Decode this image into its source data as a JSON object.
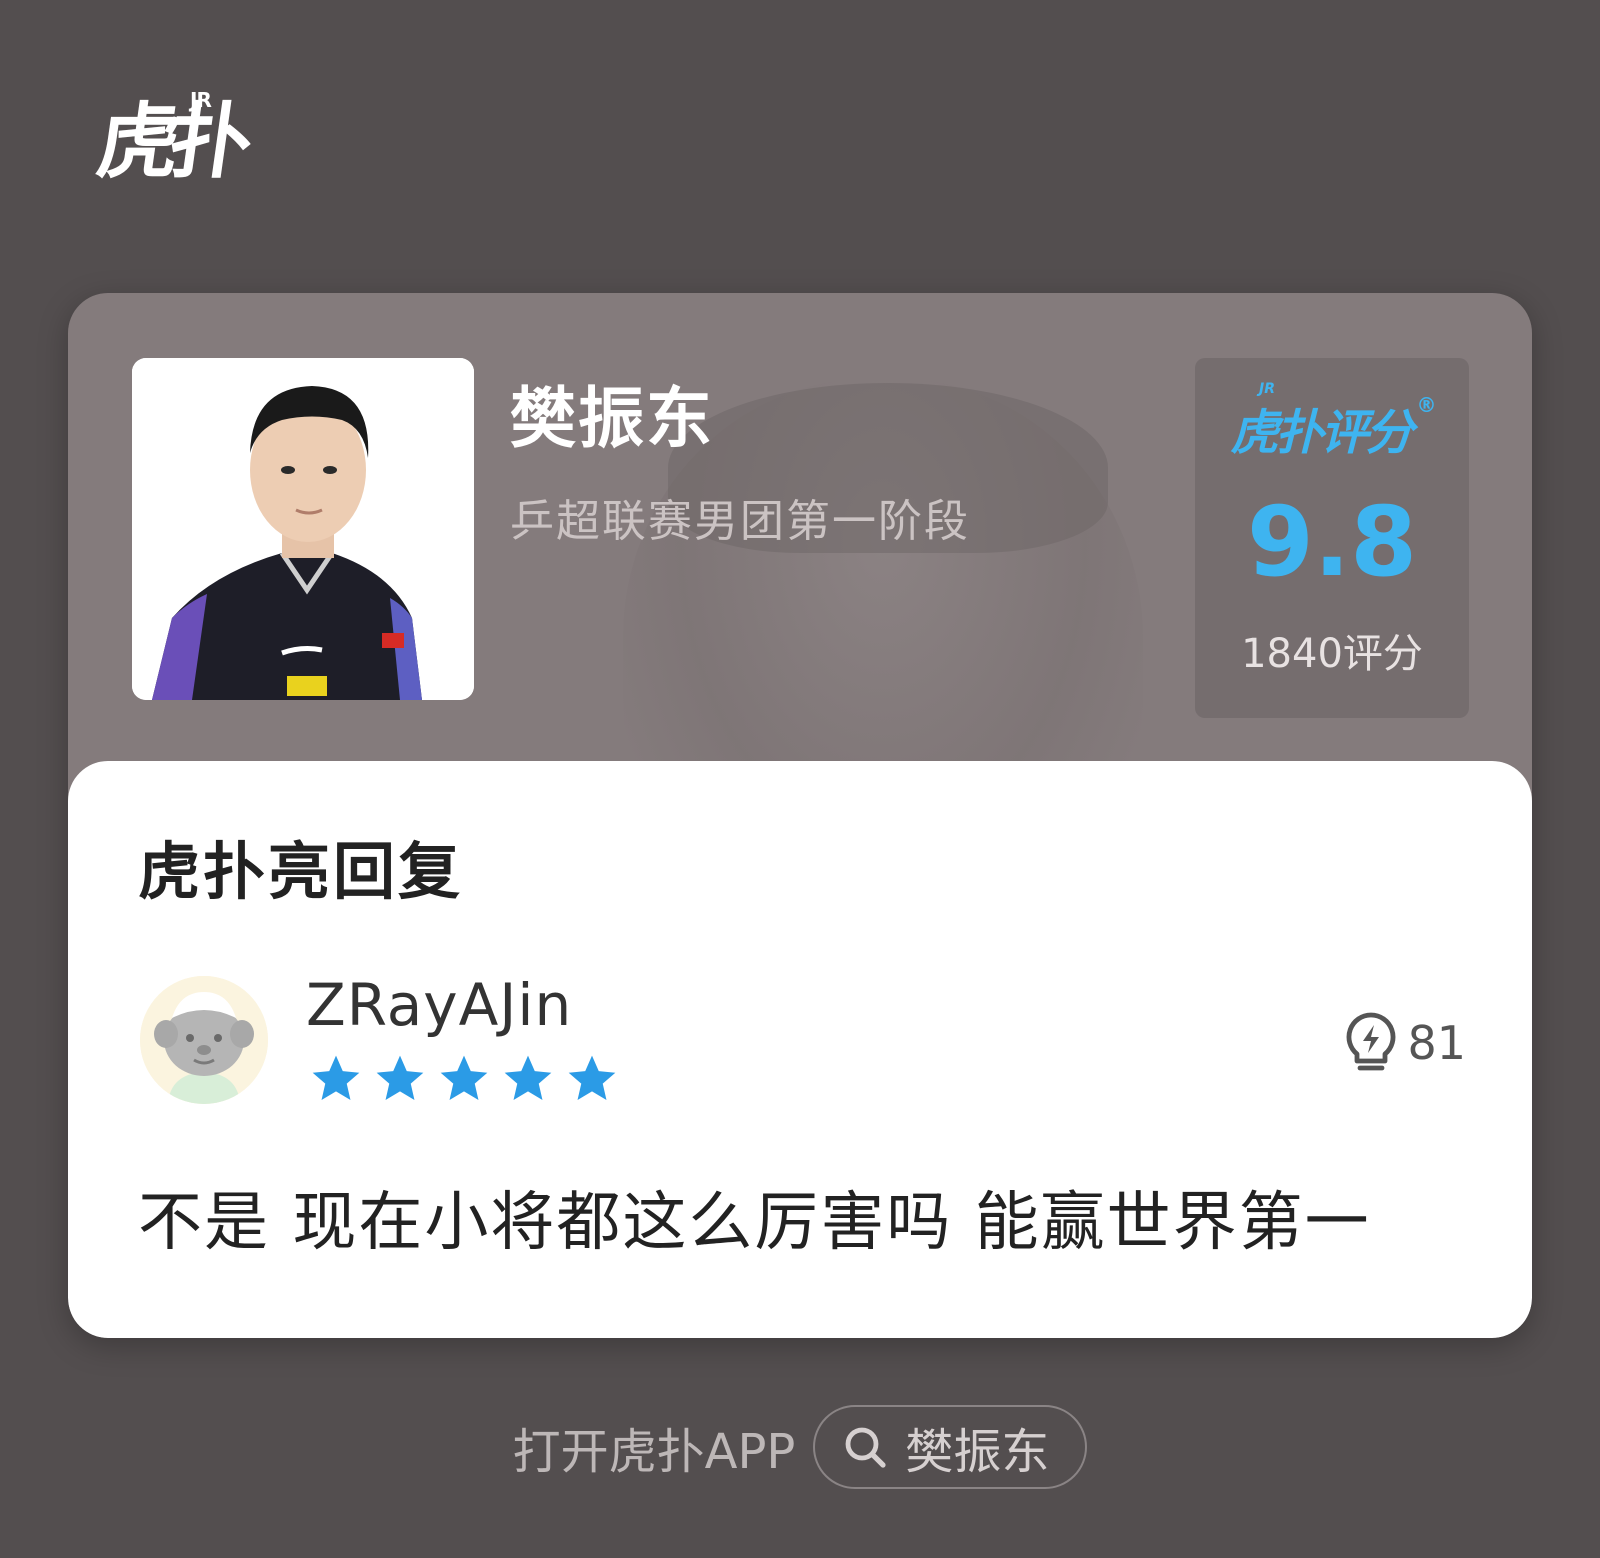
{
  "brand": {
    "logo_text": "虎扑",
    "logo_sup": "JR"
  },
  "player": {
    "name": "樊振东",
    "event": "乒超联赛男团第一阶段"
  },
  "score": {
    "brand_label": "虎扑评分",
    "brand_sup": "JR",
    "registered_mark": "®",
    "value": "9.8",
    "count_label": "1840评分",
    "color": "#3eb4f0"
  },
  "section": {
    "title": "虎扑亮回复"
  },
  "reply": {
    "username": "ZRayAJin",
    "rating_stars": 5,
    "rating_max": 5,
    "star_color": "#2b9be6",
    "light_icon": "lightbulb-icon",
    "light_count": "81",
    "comment": "不是 现在小将都这么厉害吗 能赢世界第一"
  },
  "footer": {
    "open_app_label": "打开虎扑APP",
    "search_icon": "search-icon",
    "search_term": "樊振东"
  }
}
